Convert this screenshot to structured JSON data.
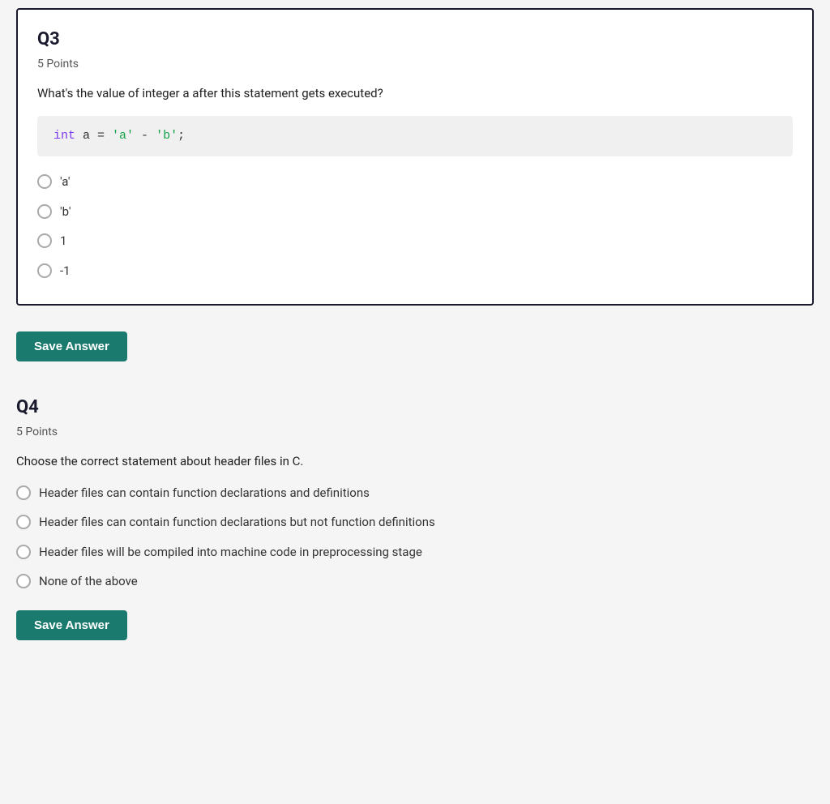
{
  "q3": {
    "title": "Q3",
    "points": "5 Points",
    "question_text": "What's the value of integer a after this statement gets executed?",
    "code": {
      "keyword": "int",
      "variable": " a = ",
      "string1": "'a'",
      "operator": " - ",
      "string2": "'b'",
      "semicolon": ";"
    },
    "options": [
      "'a'",
      "'b'",
      "1",
      "-1"
    ],
    "save_label": "Save Answer"
  },
  "q4": {
    "title": "Q4",
    "points": "5 Points",
    "question_text": "Choose the correct statement about header files in C.",
    "options": [
      "Header files can contain function declarations and definitions",
      "Header files can contain function declarations but not function definitions",
      "Header files will be compiled into machine code in preprocessing stage",
      "None of the above"
    ],
    "save_label": "Save Answer"
  }
}
